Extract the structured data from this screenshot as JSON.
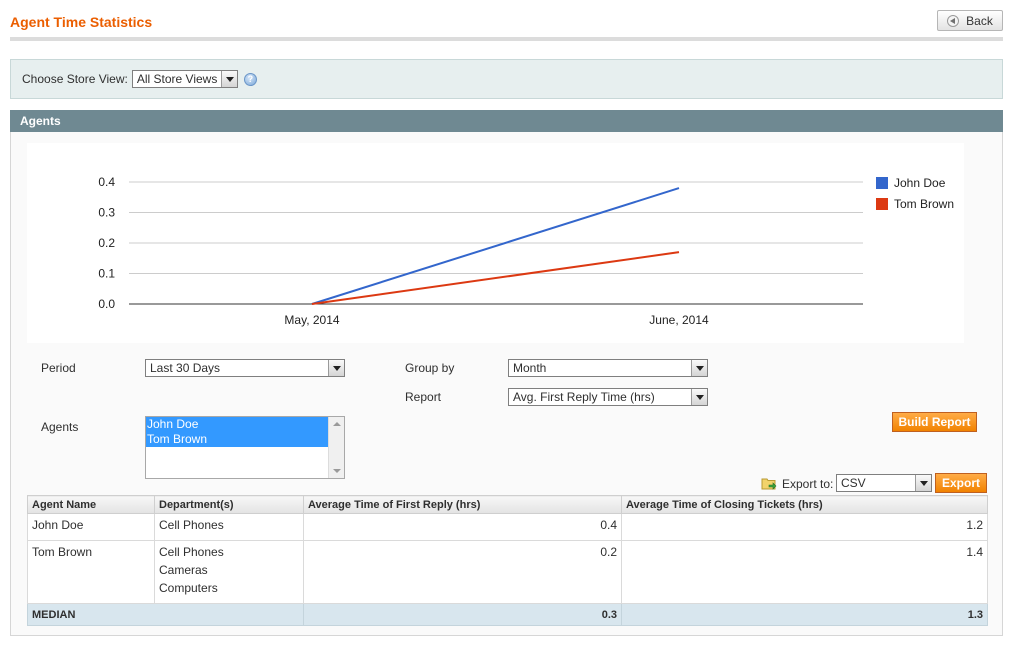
{
  "header": {
    "title": "Agent Time Statistics",
    "back_label": "Back"
  },
  "store_view": {
    "label": "Choose Store View:",
    "selected": "All Store Views"
  },
  "section": {
    "title": "Agents"
  },
  "chart_data": {
    "type": "line",
    "x": [
      "May, 2014",
      "June, 2014"
    ],
    "yticks": [
      "0.0",
      "0.1",
      "0.2",
      "0.3",
      "0.4"
    ],
    "ylim": [
      0,
      0.4
    ],
    "grid": true,
    "legend_position": "right",
    "series": [
      {
        "name": "John Doe",
        "color": "#3366cc",
        "values": [
          0,
          0.38
        ]
      },
      {
        "name": "Tom  Brown",
        "color": "#dc3912",
        "values": [
          0,
          0.17
        ]
      }
    ]
  },
  "filters": {
    "period_label": "Period",
    "period_value": "Last 30 Days",
    "group_by_label": "Group by",
    "group_by_value": "Month",
    "report_label": "Report",
    "report_value": "Avg. First Reply Time (hrs)",
    "agents_label": "Agents",
    "agents_selected": [
      "John Doe",
      "Tom Brown"
    ],
    "build_report_label": "Build Report"
  },
  "export": {
    "label": "Export to:",
    "format": "CSV",
    "button_label": "Export"
  },
  "grid": {
    "columns": [
      "Agent Name",
      "Department(s)",
      "Average Time of First Reply (hrs)",
      "Average Time of Closing Tickets (hrs)"
    ],
    "rows": [
      {
        "agent": "John Doe",
        "departments": [
          "Cell Phones"
        ],
        "first_reply": "0.4",
        "closing": "1.2"
      },
      {
        "agent": "Tom Brown",
        "departments": [
          "Cell Phones",
          "Cameras",
          "Computers"
        ],
        "first_reply": "0.2",
        "closing": "1.4"
      }
    ],
    "total": {
      "label": "MEDIAN",
      "first_reply": "0.3",
      "closing": "1.3"
    }
  }
}
